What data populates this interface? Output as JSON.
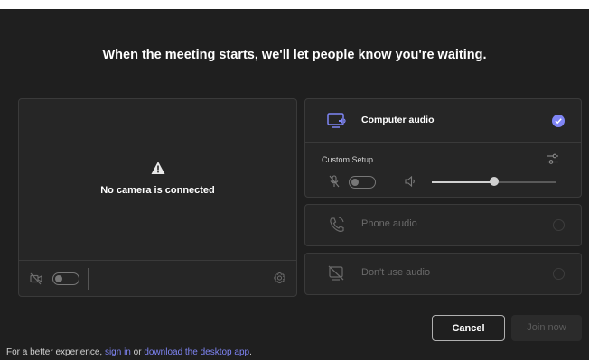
{
  "headline": "When the meeting starts, we'll let people know you're waiting.",
  "camera": {
    "message": "No camera is connected",
    "toggle_on": false
  },
  "audio": {
    "computer_audio": {
      "label": "Computer audio",
      "selected": true
    },
    "custom_setup_label": "Custom Setup",
    "mic_toggle_on": false,
    "volume_level": 0.5,
    "phone_audio": {
      "label": "Phone audio"
    },
    "dont_use_audio": {
      "label": "Don't use audio"
    }
  },
  "buttons": {
    "cancel": "Cancel",
    "join": "Join now"
  },
  "footer": {
    "prefix": "For a better experience, ",
    "sign_in": "sign in",
    "middle": " or ",
    "download": "download the desktop app",
    "suffix": "."
  },
  "colors": {
    "background": "#1f1f1f",
    "panel": "#262626",
    "accent": "#7f85f5"
  },
  "icons": [
    "warning-icon",
    "camera-off-icon",
    "gear-icon",
    "computer-audio-icon",
    "check-icon",
    "tune-icon",
    "mic-off-icon",
    "speaker-icon",
    "phone-icon",
    "no-audio-icon"
  ]
}
